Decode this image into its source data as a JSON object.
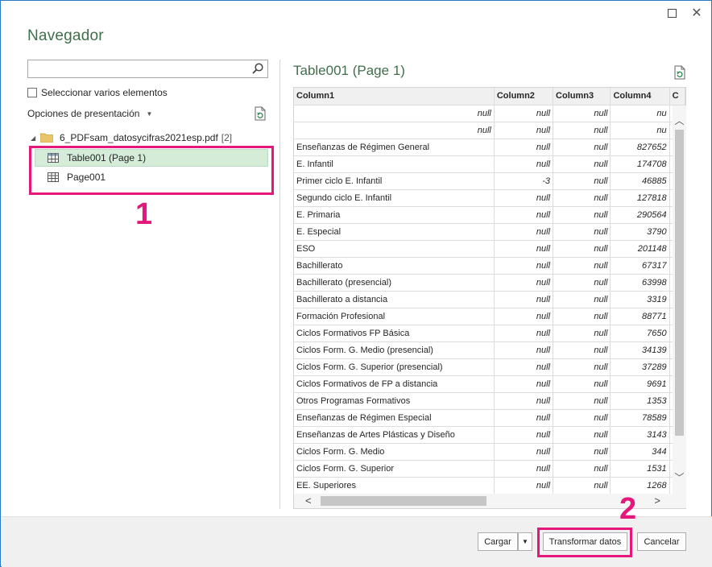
{
  "window": {
    "title": "Navegador"
  },
  "search": {
    "placeholder": "",
    "value": ""
  },
  "select_multiple_label": "Seleccionar varios elementos",
  "display_options_label": "Opciones de presentación",
  "tree": {
    "folder": {
      "label": "6_PDFsam_datosycifras2021esp.pdf",
      "count": "[2]"
    },
    "items": [
      {
        "label": "Table001 (Page 1)",
        "selected": true
      },
      {
        "label": "Page001",
        "selected": false
      }
    ]
  },
  "annotations": {
    "step1": "1",
    "step2": "2",
    "highlight_color": "#e6177a"
  },
  "preview": {
    "title": "Table001 (Page 1)",
    "columns": [
      "Column1",
      "Column2",
      "Column3",
      "Column4",
      "C"
    ],
    "rows": [
      [
        "null",
        "null",
        "null",
        "nu"
      ],
      [
        "null",
        "null",
        "null",
        "nu"
      ],
      [
        "Enseñanzas de Régimen General",
        "null",
        "null",
        "827652"
      ],
      [
        "E. Infantil",
        "null",
        "null",
        "174708"
      ],
      [
        "Primer ciclo E. Infantil",
        "-3",
        "null",
        "46885"
      ],
      [
        "Segundo ciclo E. Infantil",
        "null",
        "null",
        "127818"
      ],
      [
        "E. Primaria",
        "null",
        "null",
        "290564"
      ],
      [
        "E. Especial",
        "null",
        "null",
        "3790"
      ],
      [
        "ESO",
        "null",
        "null",
        "201148"
      ],
      [
        "Bachillerato",
        "null",
        "null",
        "67317"
      ],
      [
        "Bachillerato (presencial)",
        "null",
        "null",
        "63998"
      ],
      [
        "Bachillerato a distancia",
        "null",
        "null",
        "3319"
      ],
      [
        "Formación Profesional",
        "null",
        "null",
        "88771"
      ],
      [
        "Ciclos Formativos FP Básica",
        "null",
        "null",
        "7650"
      ],
      [
        "Ciclos Form. G. Medio (presencial)",
        "null",
        "null",
        "34139"
      ],
      [
        "Ciclos Form. G. Superior (presencial)",
        "null",
        "null",
        "37289"
      ],
      [
        "Ciclos Formativos de FP a distancia",
        "null",
        "null",
        "9691"
      ],
      [
        "Otros Programas Formativos",
        "null",
        "null",
        "1353"
      ],
      [
        "Enseñanzas de Régimen Especial",
        "null",
        "null",
        "78589"
      ],
      [
        "Enseñanzas de Artes Plásticas y Diseño",
        "null",
        "null",
        "3143"
      ],
      [
        "Ciclos Form. G. Medio",
        "null",
        "null",
        "344"
      ],
      [
        "Ciclos Form. G. Superior",
        "null",
        "null",
        "1531"
      ],
      [
        "EE. Superiores",
        "null",
        "null",
        "1268"
      ]
    ]
  },
  "footer": {
    "load_label": "Cargar",
    "transform_label": "Transformar datos",
    "cancel_label": "Cancelar"
  },
  "colors": {
    "accent_green": "#3f6f4a",
    "selection": "#d4ecd8",
    "window_border": "#2b79c2"
  }
}
